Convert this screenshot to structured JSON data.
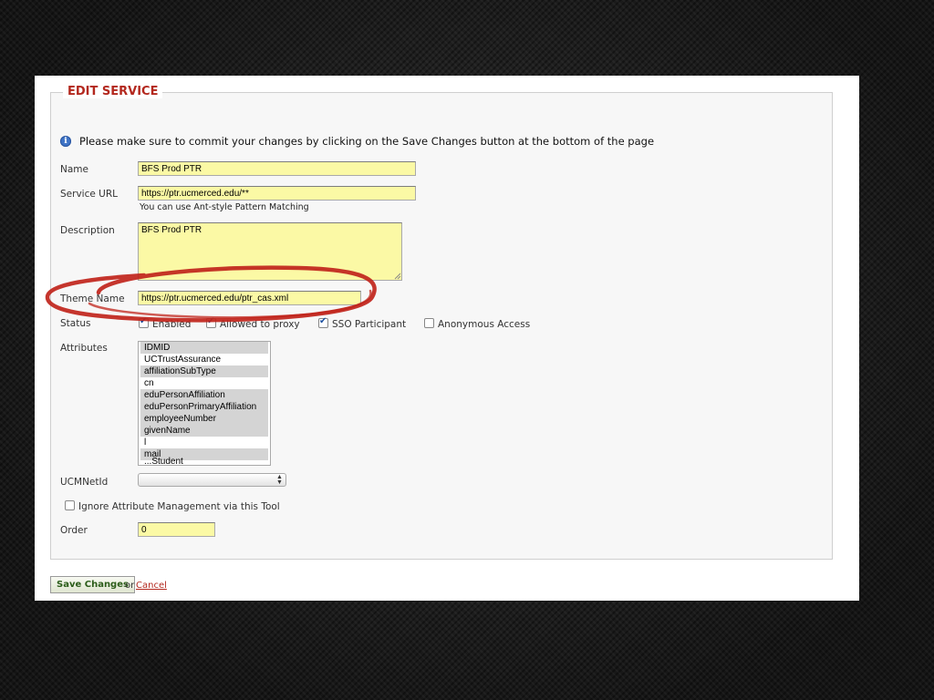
{
  "form": {
    "legend": "EDIT SERVICE",
    "notice": "Please make sure to commit your changes by clicking on the Save Changes button at the bottom of the page",
    "name": {
      "label": "Name",
      "value": "BFS Prod PTR"
    },
    "service_url": {
      "label": "Service URL",
      "value": "https://ptr.ucmerced.edu/**",
      "hint": "You can use Ant-style Pattern Matching"
    },
    "description": {
      "label": "Description",
      "value": "BFS Prod PTR"
    },
    "theme_name": {
      "label": "Theme Name",
      "value": "https://ptr.ucmerced.edu/ptr_cas.xml"
    },
    "status": {
      "label": "Status",
      "options": [
        {
          "label": "Enabled",
          "checked": true
        },
        {
          "label": "Allowed to proxy",
          "checked": true
        },
        {
          "label": "SSO Participant",
          "checked": true
        },
        {
          "label": "Anonymous Access",
          "checked": false
        }
      ]
    },
    "attributes": {
      "label": "Attributes",
      "items": [
        {
          "label": "IDMID",
          "selected": true
        },
        {
          "label": "UCTrustAssurance",
          "selected": false
        },
        {
          "label": "affiliationSubType",
          "selected": true
        },
        {
          "label": "cn",
          "selected": false
        },
        {
          "label": "eduPersonAffiliation",
          "selected": true
        },
        {
          "label": "eduPersonPrimaryAffiliation",
          "selected": true
        },
        {
          "label": "employeeNumber",
          "selected": true
        },
        {
          "label": "givenName",
          "selected": true
        },
        {
          "label": "l",
          "selected": false
        },
        {
          "label": "mail",
          "selected": true
        },
        {
          "label": "...Student",
          "selected": false
        }
      ]
    },
    "ucmnetid": {
      "label": "UCMNetId",
      "value": ""
    },
    "ignore_attr": {
      "label": "Ignore Attribute Management via this Tool",
      "checked": false
    },
    "order": {
      "label": "Order",
      "value": "0"
    },
    "save_label": "Save Changes",
    "or_text": "or",
    "cancel_label": "Cancel"
  },
  "colors": {
    "legend": "#b3281e",
    "input_bg": "#fbf9a5",
    "highlight_circle": "#c0241b",
    "save_text": "#2c5d1a"
  },
  "icons": {
    "notice": "info-icon",
    "select_arrow": "up-down-arrows-icon"
  }
}
